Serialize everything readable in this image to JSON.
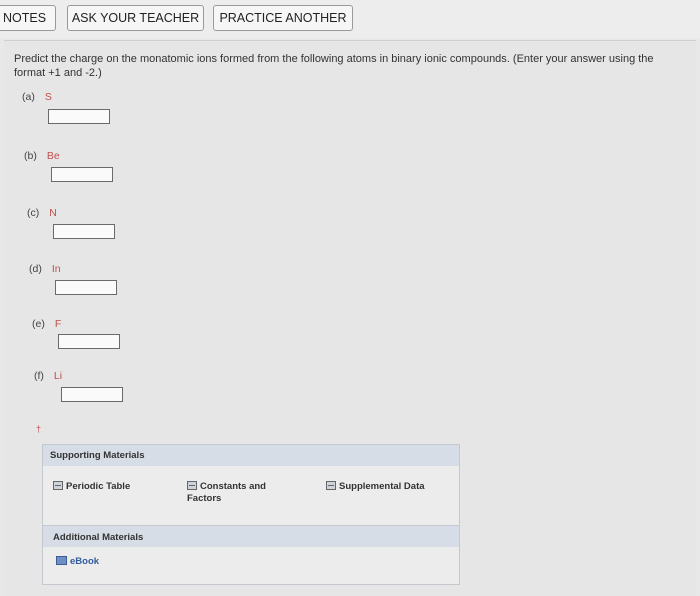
{
  "toolbar": {
    "notes_label": "NOTES",
    "ask_teacher_label": "ASK YOUR TEACHER",
    "practice_another_label": "PRACTICE ANOTHER"
  },
  "question": {
    "prompt": "Predict the charge on the monatomic ions formed from the following atoms in binary ionic compounds. (Enter your answer using the format +1 and -2.)",
    "parts": [
      {
        "label": "(a)",
        "symbol": "S",
        "value": ""
      },
      {
        "label": "(b)",
        "symbol": "Be",
        "value": ""
      },
      {
        "label": "(c)",
        "symbol": "N",
        "value": ""
      },
      {
        "label": "(d)",
        "symbol": "In",
        "value": ""
      },
      {
        "label": "(e)",
        "symbol": "F",
        "value": ""
      },
      {
        "label": "(f)",
        "symbol": "Li",
        "value": ""
      }
    ],
    "footnote_marker": "†"
  },
  "supporting": {
    "title": "Supporting Materials",
    "links": [
      "Periodic Table",
      "Constants and Factors",
      "Supplemental Data"
    ]
  },
  "additional": {
    "title": "Additional Materials",
    "links": [
      "eBook"
    ]
  },
  "colors": {
    "element_symbol": "#c0504d",
    "header_band": "#d6dde6",
    "ebook_link": "#2f5c9c"
  }
}
